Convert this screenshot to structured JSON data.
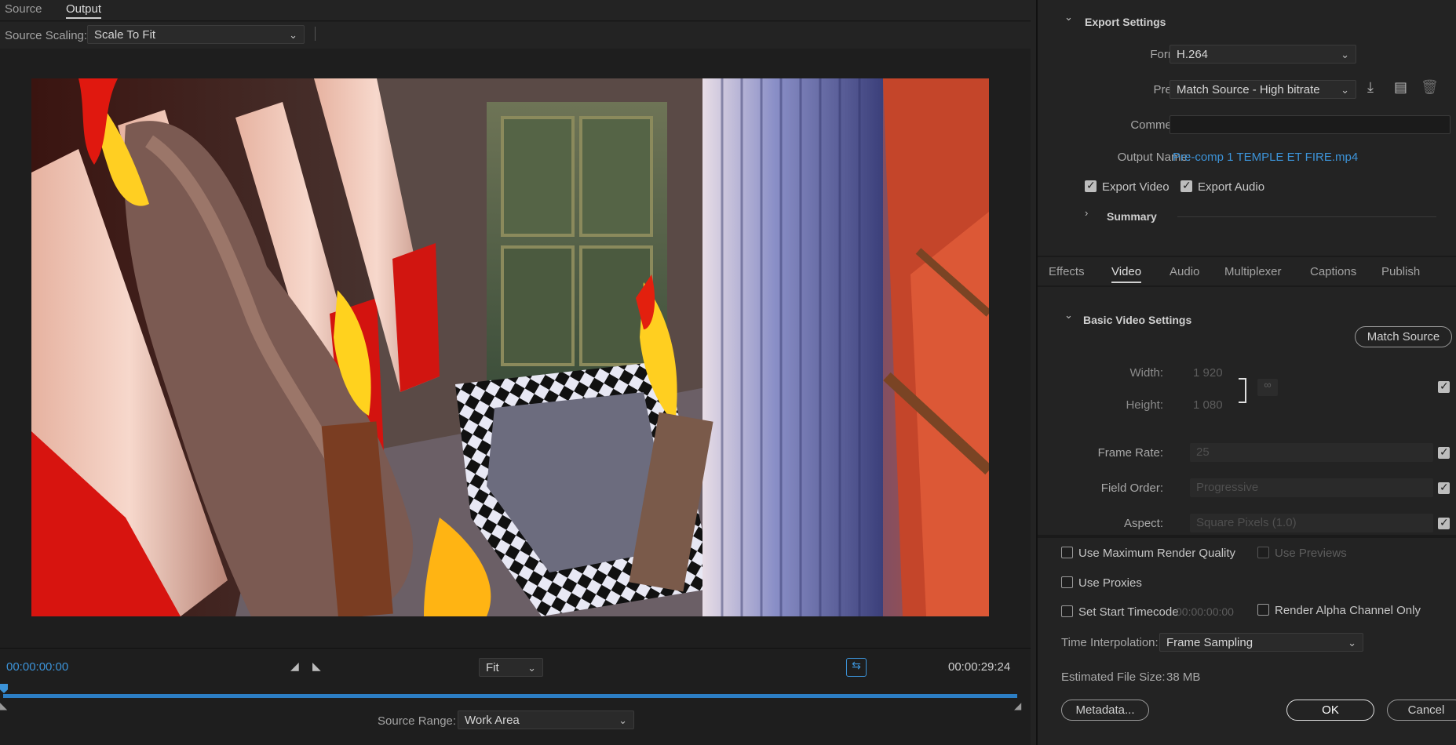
{
  "source_tabs": [
    {
      "label": "Source"
    },
    {
      "label": "Output"
    }
  ],
  "source_scaling": {
    "label": "Source Scaling:",
    "value": "Scale To Fit"
  },
  "transport": {
    "timecode_start": "00:00:00:00",
    "timecode_end": "00:00:29:24",
    "zoom": "Fit",
    "source_range_label": "Source Range:",
    "source_range_value": "Work Area"
  },
  "export_settings": {
    "title": "Export Settings",
    "format_label": "Format:",
    "format_value": "H.264",
    "preset_label": "Preset:",
    "preset_value": "Match Source - High bitrate",
    "comments_label": "Comments:",
    "comments_value": "",
    "output_name_label": "Output Name:",
    "output_name_value": "Pre-comp 1 TEMPLE ET FIRE.mp4",
    "export_video_label": "Export Video",
    "export_audio_label": "Export Audio",
    "summary_label": "Summary"
  },
  "settings_tabs": [
    {
      "label": "Effects"
    },
    {
      "label": "Video"
    },
    {
      "label": "Audio"
    },
    {
      "label": "Multiplexer"
    },
    {
      "label": "Captions"
    },
    {
      "label": "Publish"
    }
  ],
  "basic_video": {
    "title": "Basic Video Settings",
    "match_source_label": "Match Source",
    "width_label": "Width:",
    "width_value": "1 920",
    "height_label": "Height:",
    "height_value": "1 080",
    "frame_rate_label": "Frame Rate:",
    "frame_rate_value": "25",
    "field_order_label": "Field Order:",
    "field_order_value": "Progressive",
    "aspect_label": "Aspect:",
    "aspect_value": "Square Pixels (1.0)"
  },
  "render_options": {
    "max_render_quality": "Use Maximum Render Quality",
    "use_previews": "Use Previews",
    "use_proxies": "Use Proxies",
    "set_start_timecode": "Set Start Timecode",
    "start_timecode_value": "00:00:00:00",
    "render_alpha": "Render Alpha Channel Only",
    "time_interpolation_label": "Time Interpolation:",
    "time_interpolation_value": "Frame Sampling",
    "estimated_size_label": "Estimated File Size:",
    "estimated_size_value": "38 MB"
  },
  "buttons": {
    "metadata": "Metadata...",
    "ok": "OK",
    "cancel": "Cancel"
  },
  "colors": {
    "accent": "#3c93d8",
    "timeline": "#2c7ec4",
    "panel": "#232323"
  }
}
